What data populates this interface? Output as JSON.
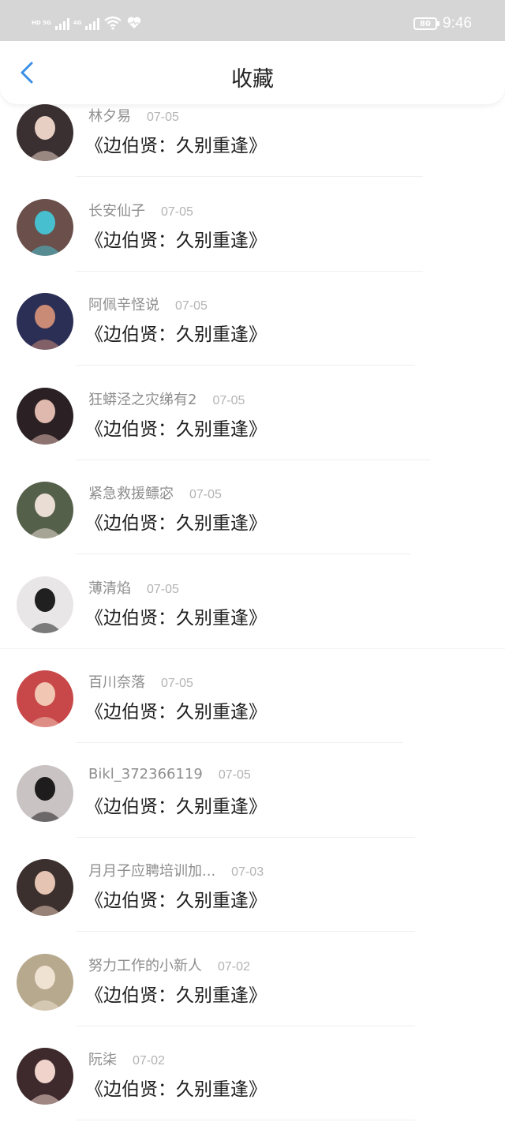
{
  "status_bar": {
    "net_labels": [
      "HD 5G",
      "4G"
    ],
    "battery": "80",
    "time": "9:46",
    "icons": [
      "signal-icon",
      "signal-icon",
      "wifi-icon",
      "heart-icon",
      "battery-icon"
    ]
  },
  "nav": {
    "back_icon": "chevron-left-icon",
    "title": "收藏",
    "accent": "#3b8fe6"
  },
  "items": [
    {
      "name": "林夕易",
      "date": "07-05",
      "title": "《边伯贤：久别重逢》",
      "avatar_color": "#3a2f31",
      "avatar_accent": "#e8cfc4"
    },
    {
      "name": "长安仙子",
      "date": "07-05",
      "title": "《边伯贤：久别重逢》",
      "avatar_color": "#6a4f4a",
      "avatar_accent": "#48bfcf"
    },
    {
      "name": "阿佩辛怪说",
      "date": "07-05",
      "title": "《边伯贤：久别重逢》",
      "avatar_color": "#2c2f55",
      "avatar_accent": "#c98a76"
    },
    {
      "name": "狂蟒泾之灾绨有2",
      "date": "07-05",
      "title": "《边伯贤：久别重逢》",
      "avatar_color": "#2b2124",
      "avatar_accent": "#e0b9ae"
    },
    {
      "name": "紧急救援鳔宓",
      "date": "07-05",
      "title": "《边伯贤：久别重逢》",
      "avatar_color": "#55604a",
      "avatar_accent": "#e9ddd4"
    },
    {
      "name": "薄清焰",
      "date": "07-05",
      "title": "《边伯贤：久别重逢》",
      "avatar_color": "#e8e6e6",
      "avatar_accent": "#202020"
    },
    {
      "name": "百川奈落",
      "date": "07-05",
      "title": "《边伯贤：久别重逢》",
      "avatar_color": "#c8484a",
      "avatar_accent": "#f1c7b4"
    },
    {
      "name": "Bikl_372366119",
      "date": "07-05",
      "title": "《边伯贤：久别重逢》",
      "avatar_color": "#c9c3c4",
      "avatar_accent": "#1f1c1e"
    },
    {
      "name": "月月子应聘培训加...",
      "date": "07-03",
      "title": "《边伯贤：久别重逢》",
      "avatar_color": "#3b302d",
      "avatar_accent": "#e6c4b4"
    },
    {
      "name": "努力工作的小新人",
      "date": "07-02",
      "title": "《边伯贤：久别重逢》",
      "avatar_color": "#b7a98d",
      "avatar_accent": "#efe2d3"
    },
    {
      "name": "阮柒",
      "date": "07-02",
      "title": "《边伯贤：久别重逢》",
      "avatar_color": "#3e2a2c",
      "avatar_accent": "#f0d4cc"
    }
  ]
}
